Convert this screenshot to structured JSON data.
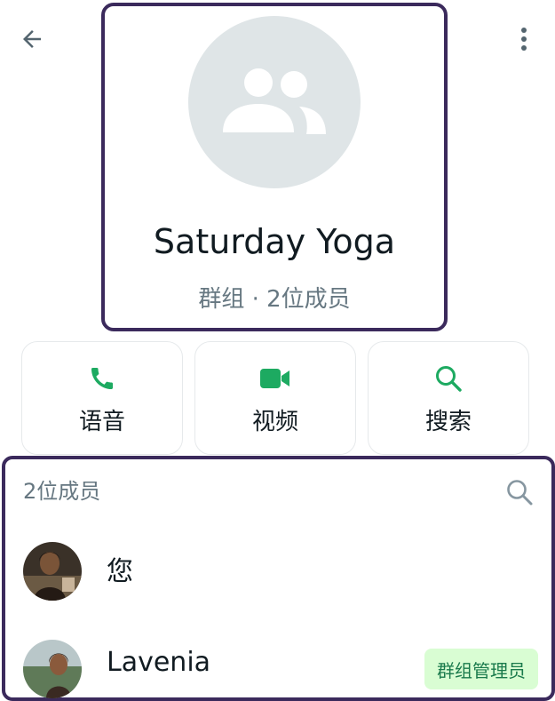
{
  "header": {
    "title": "Saturday Yoga",
    "subtitle": "群组 · 2位成员"
  },
  "icons": {
    "back": "arrow-back-icon",
    "more": "more-vert-icon",
    "group_avatar": "group-icon",
    "voice": "phone-icon",
    "video": "videocam-icon",
    "search": "search-icon"
  },
  "actions": [
    {
      "label": "语音"
    },
    {
      "label": "视频"
    },
    {
      "label": "搜索"
    }
  ],
  "members": {
    "count_label": "2位成员",
    "list": [
      {
        "name": "您"
      },
      {
        "name": "Lavenia",
        "badge": "群组管理员"
      }
    ]
  },
  "colors": {
    "accent": "#1daa61",
    "highlight_border": "#3b2a5c",
    "badge_bg": "#d9fdd3",
    "secondary_text": "#667781"
  }
}
